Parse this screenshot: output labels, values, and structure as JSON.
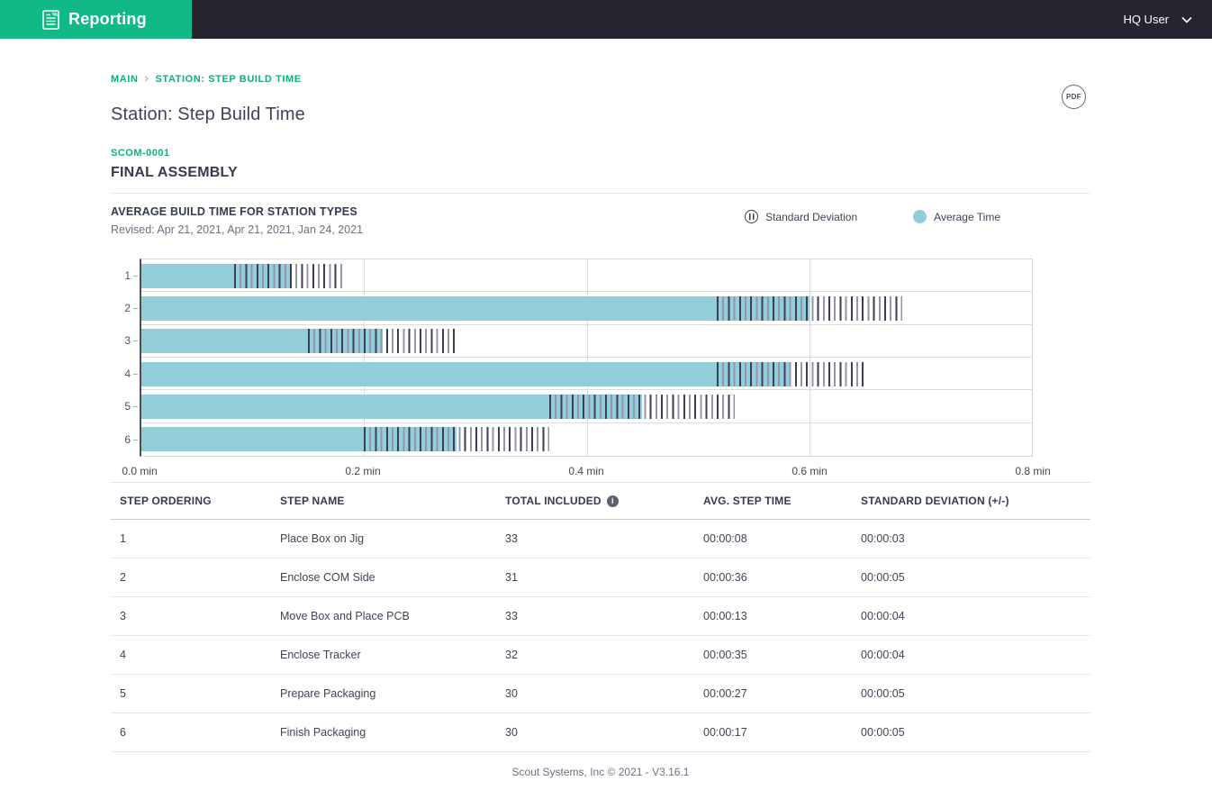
{
  "topbar": {
    "brand_label": "Reporting",
    "user_label": "HQ User"
  },
  "breadcrumb": {
    "items": [
      {
        "label": "MAIN"
      },
      {
        "label": "STATION: STEP BUILD TIME"
      }
    ],
    "separator": "›"
  },
  "page": {
    "title": "Station: Step Build Time",
    "station_code": "SCOM-0001",
    "station_name": "FINAL ASSEMBLY",
    "pdf_label": "PDF"
  },
  "chart": {
    "title": "AVERAGE BUILD TIME FOR STATION TYPES",
    "revised": "Revised: Apr 21, 2021, Apr 21, 2021, Jan 24, 2021",
    "legend": [
      {
        "label": "Standard Deviation"
      },
      {
        "label": "Average Time"
      }
    ]
  },
  "chart_data": {
    "type": "bar",
    "orientation": "horizontal",
    "title": "AVERAGE BUILD TIME FOR STATION TYPES",
    "categories": [
      "1",
      "2",
      "3",
      "4",
      "5",
      "6"
    ],
    "series": [
      {
        "name": "Average Time",
        "unit": "seconds",
        "values": [
          8,
          36,
          13,
          35,
          27,
          17
        ]
      },
      {
        "name": "Standard Deviation",
        "unit": "seconds",
        "values": [
          3,
          5,
          4,
          4,
          5,
          5
        ]
      }
    ],
    "x_ticks": [
      "0.0 min",
      "0.2 min",
      "0.4 min",
      "0.6 min",
      "0.8 min"
    ],
    "xlim_minutes": [
      0,
      0.8
    ],
    "grid": true,
    "legend_position": "top-right",
    "bar_color": "#92ced9",
    "sd_hatch_color": "#3d3d58"
  },
  "table": {
    "headers": [
      "STEP ORDERING",
      "STEP NAME",
      "TOTAL INCLUDED",
      "AVG. STEP TIME",
      "STANDARD DEVIATION (+/-)"
    ],
    "info_icon": "i",
    "rows": [
      [
        "1",
        "Place Box on Jig",
        "33",
        "00:00:08",
        "00:00:03"
      ],
      [
        "2",
        "Enclose COM Side",
        "31",
        "00:00:36",
        "00:00:05"
      ],
      [
        "3",
        "Move Box and Place PCB",
        "33",
        "00:00:13",
        "00:00:04"
      ],
      [
        "4",
        "Enclose Tracker",
        "32",
        "00:00:35",
        "00:00:04"
      ],
      [
        "5",
        "Prepare Packaging",
        "30",
        "00:00:27",
        "00:00:05"
      ],
      [
        "6",
        "Finish Packaging",
        "30",
        "00:00:17",
        "00:00:05"
      ]
    ]
  },
  "footer": {
    "text": "Scout Systems, Inc © 2021 - V3.16.1"
  },
  "colors": {
    "brand_green": "#11b984",
    "link_green": "#10ad7e",
    "topbar_dark": "#25252f",
    "bar_teal": "#92ced9",
    "sd_stripe_dark": "#3d3d58",
    "text_dark": "#353b4f"
  }
}
